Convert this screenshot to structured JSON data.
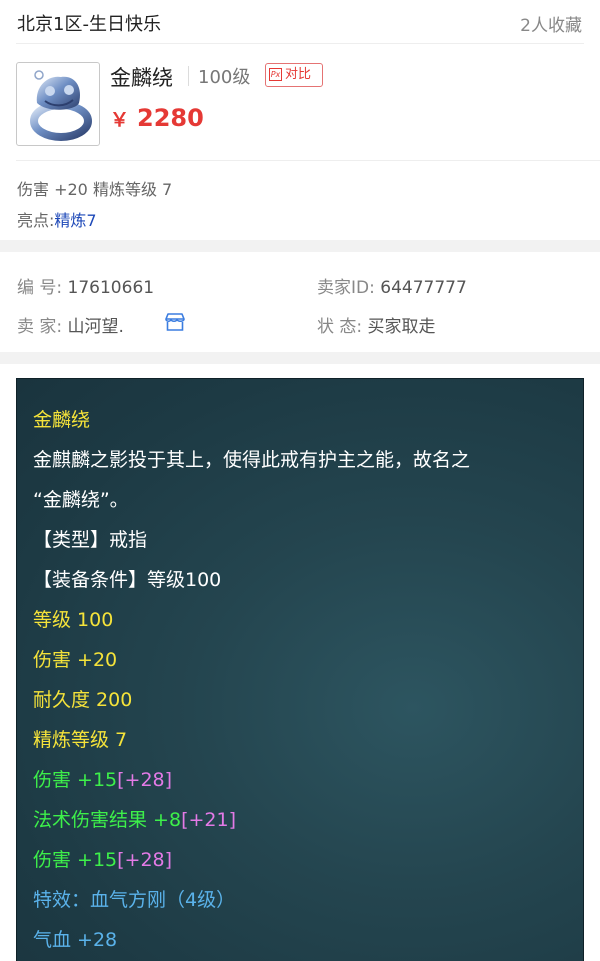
{
  "header": {
    "server": "北京1区-生日快乐",
    "favorites": "2人收藏"
  },
  "item": {
    "name": "金麟绕",
    "level": "100级",
    "compare_label": "对比",
    "compare_icon": "Px",
    "price_symbol": "￥",
    "price": "2280",
    "attrs": "伤害 +20 精炼等级 7",
    "highlight_label": "亮点:",
    "highlight_value": "精炼7"
  },
  "info": {
    "id_label": "编 号:",
    "id_value": "17610661",
    "seller_id_label": "卖家ID:",
    "seller_id_value": "64477777",
    "seller_label": "卖 家:",
    "seller_value": "山河望.",
    "status_label": "状 态:",
    "status_value": "买家取走"
  },
  "description": {
    "title": "金麟绕",
    "text_line1": "金麒麟之影投于其上，使得此戒有护主之能，故名之",
    "text_line2": "“金麟绕”。",
    "type_line": "【类型】戒指",
    "req_line": "【装备条件】等级100",
    "level_line": "等级 100",
    "damage_line": "伤害 +20",
    "durability_line": "耐久度 200",
    "refine_line": "精炼等级 7",
    "bonus1_main": "伤害 +15",
    "bonus1_extra": "[+28]",
    "bonus2_main": "法术伤害结果 +8",
    "bonus2_extra": "[+21]",
    "bonus3_main": "伤害 +15",
    "bonus3_extra": "[+28]",
    "special_line": "特效：血气方刚（4级）",
    "hp_line": "气血 +28"
  },
  "colors": {
    "price": "#e53935",
    "highlight": "#1e49b8",
    "panel_bg": "#24454f",
    "yellow_text": "#f5e33a",
    "green_text": "#3df04a",
    "pink_text": "#e37ae6",
    "blue_text": "#5ab2ea"
  },
  "icons": {
    "item_image": "ring-image",
    "store": "store-icon",
    "compare": "compare-icon"
  }
}
